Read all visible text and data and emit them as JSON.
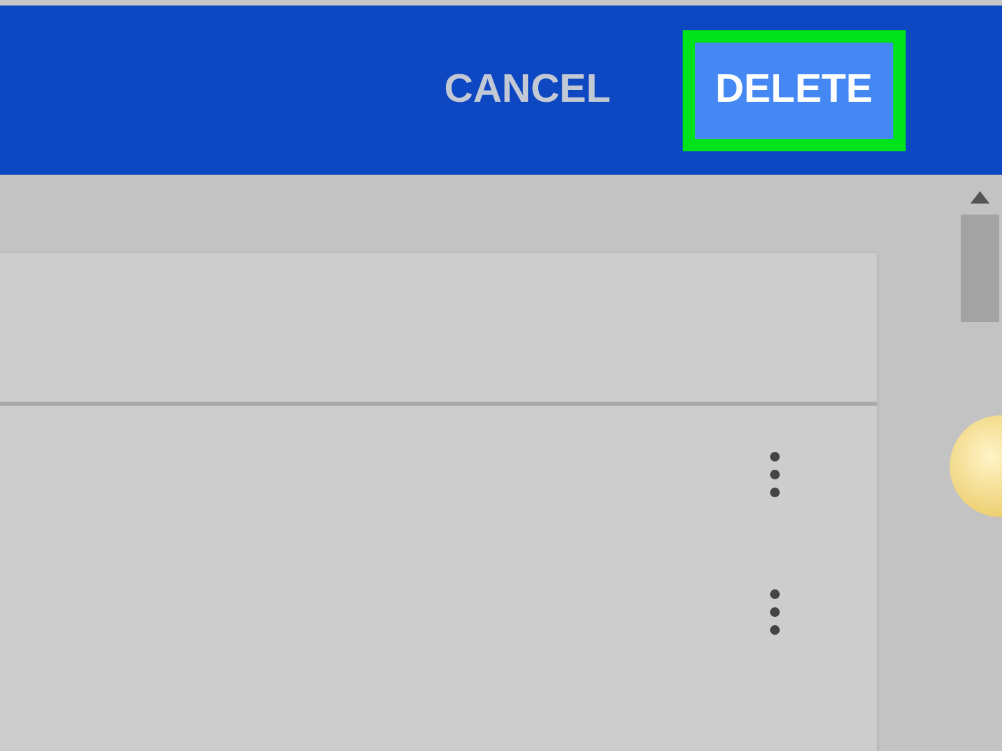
{
  "toolbar": {
    "buttons": [
      {
        "label": "CANCEL",
        "kind": "text",
        "highlighted": false
      },
      {
        "label": "DELETE",
        "kind": "primary",
        "highlighted": true
      }
    ]
  },
  "list": {
    "rows": [
      {
        "menu": true
      },
      {
        "menu": true
      }
    ]
  }
}
